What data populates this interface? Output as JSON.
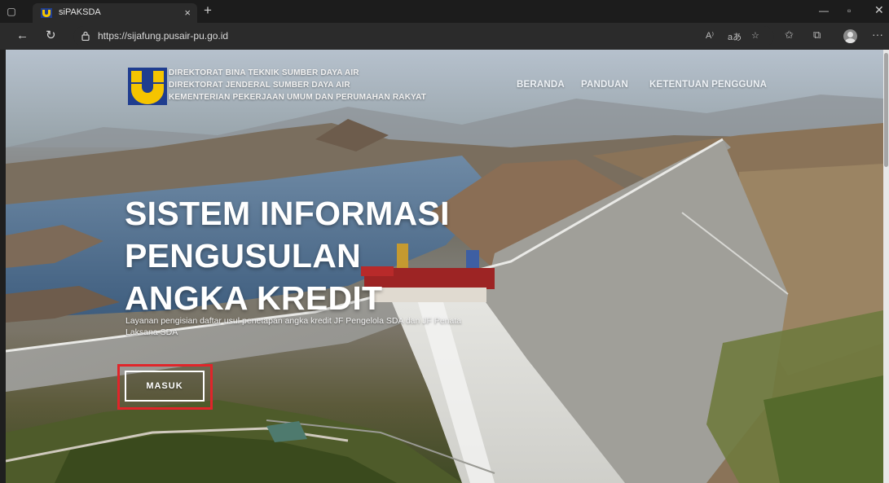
{
  "browser": {
    "tab_title": "siPAKSDA",
    "url": "https://sijafung.pusair-pu.go.id",
    "new_tab_symbol": "+",
    "close_symbol": "×"
  },
  "organization": {
    "line1": "DIREKTORAT BINA TEKNIK SUMBER DAYA AIR",
    "line2": "DIREKTORAT JENDERAL SUMBER DAYA AIR",
    "line3": "KEMENTERIAN PEKERJAAN UMUM DAN PERUMAHAN RAKYAT"
  },
  "nav": {
    "items": [
      "BERANDA",
      "PANDUAN",
      "KETENTUAN PENGGUNA"
    ]
  },
  "hero": {
    "title_line1": "SISTEM INFORMASI",
    "title_line2": "PENGUSULAN",
    "title_line3": "ANGKA KREDIT",
    "subtitle": "Layanan pengisian daftar usul penetapan angka kredit JF Pengelola SDA dan JF Penata Laksana SDA",
    "button_label": "MASUK"
  },
  "colors": {
    "logo_blue": "#1f3d8f",
    "logo_yellow": "#f5c400",
    "highlight": "#e0252a"
  }
}
